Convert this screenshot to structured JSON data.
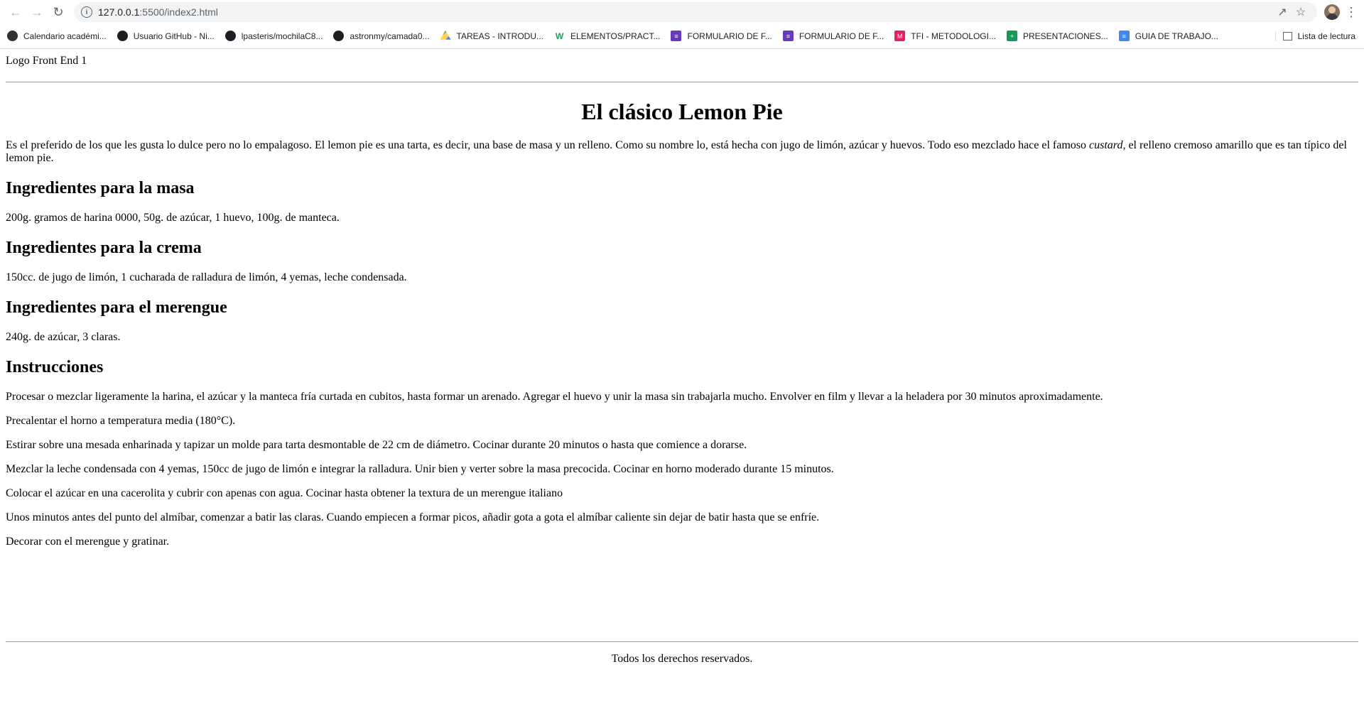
{
  "browser": {
    "url_host": "127.0.0.1",
    "url_path": ":5500/index2.html",
    "bookmarks": [
      {
        "label": "Calendario académi...",
        "icon": "cal"
      },
      {
        "label": "Usuario GitHub - Ni...",
        "icon": "gh"
      },
      {
        "label": "lpasteris/mochilaC8...",
        "icon": "gh"
      },
      {
        "label": "astronmy/camada0...",
        "icon": "gh"
      },
      {
        "label": "TAREAS - INTRODU...",
        "icon": "drive"
      },
      {
        "label": "ELEMENTOS/PRACT...",
        "icon": "w"
      },
      {
        "label": "FORMULARIO DE F...",
        "icon": "form"
      },
      {
        "label": "FORMULARIO DE F...",
        "icon": "form"
      },
      {
        "label": "TFI - METODOLOGI...",
        "icon": "m"
      },
      {
        "label": "PRESENTACIONES...",
        "icon": "sheet"
      },
      {
        "label": "GUIA DE TRABAJO...",
        "icon": "doc"
      }
    ],
    "reading_list": "Lista de lectura"
  },
  "page": {
    "logo": "Logo Front End 1",
    "title": "El clásico Lemon Pie",
    "intro_before": "Es el preferido de los que les gusta lo dulce pero no lo empalagoso. El lemon pie es una tarta, es decir, una base de masa y un relleno. Como su nombre lo, está hecha con jugo de limón, azúcar y huevos. Todo eso mezclado hace el famoso ",
    "intro_em": "custard",
    "intro_after": ", el relleno cremoso amarillo que es tan típico del lemon pie.",
    "sections": [
      {
        "heading": "Ingredientes para la masa",
        "text": "200g. gramos de harina 0000, 50g. de azúcar, 1 huevo, 100g. de manteca."
      },
      {
        "heading": "Ingredientes para la crema",
        "text": "150cc. de jugo de limón, 1 cucharada de ralladura de limón, 4 yemas, leche condensada."
      },
      {
        "heading": "Ingredientes para el merengue",
        "text": "240g. de azúcar, 3 claras."
      }
    ],
    "instructions_heading": "Instrucciones",
    "instructions": [
      "Procesar o mezclar ligeramente la harina, el azúcar y la manteca fría curtada en cubitos, hasta formar un arenado. Agregar el huevo y unir la masa sin trabajarla mucho. Envolver en film y llevar a la heladera por 30 minutos aproximadamente.",
      "Precalentar el horno a temperatura media (180°C).",
      "Estirar sobre una mesada enharinada y tapizar un molde para tarta desmontable de 22 cm de diámetro. Cocinar durante 20 minutos o hasta que comience a dorarse.",
      "Mezclar la leche condensada con 4 yemas, 150cc de jugo de limón e integrar la ralladura. Unir bien y verter sobre la masa precocida. Cocinar en horno moderado durante 15 minutos.",
      "Colocar el azúcar en una cacerolita y cubrir con apenas con agua. Cocinar hasta obtener la textura de un merengue italiano",
      "Unos minutos antes del punto del almíbar, comenzar a batir las claras. Cuando empiecen a formar picos, añadir gota a gota el almíbar caliente sin dejar de batir hasta que se enfríe.",
      "Decorar con el merengue y gratinar."
    ],
    "footer": "Todos los derechos reservados."
  }
}
